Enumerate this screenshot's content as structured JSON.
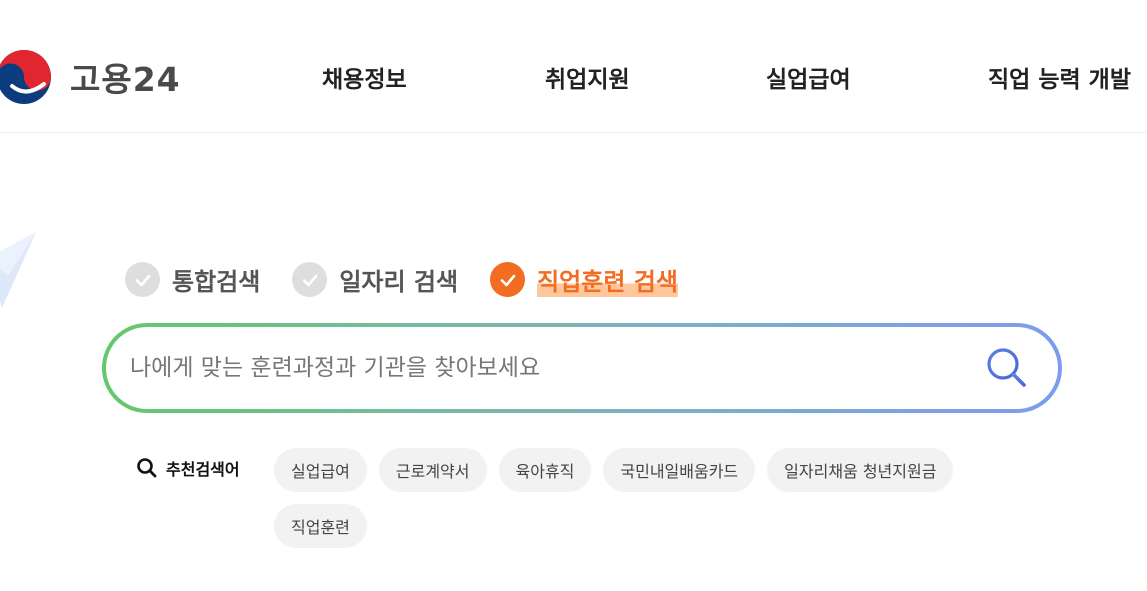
{
  "header": {
    "logo_text": "고용24",
    "nav": [
      "채용정보",
      "취업지원",
      "실업급여",
      "직업 능력 개발"
    ]
  },
  "search_tabs": [
    {
      "label": "통합검색",
      "active": false
    },
    {
      "label": "일자리 검색",
      "active": false
    },
    {
      "label": "직업훈련 검색",
      "active": true
    }
  ],
  "search": {
    "placeholder": "나에게 맞는 훈련과정과 기관을 찾아보세요",
    "value": ""
  },
  "recommended": {
    "label": "추천검색어",
    "keywords": [
      "실업급여",
      "근로계약서",
      "육아휴직",
      "국민내일배움카드",
      "일자리채움 청년지원금",
      "직업훈련"
    ]
  },
  "colors": {
    "accent": "#f26c22",
    "gradient_start": "#62c86c",
    "gradient_end": "#7b9cf0",
    "chip_bg": "#f2f2f2"
  },
  "icons": {
    "logo": "taegeuk-logo-icon",
    "tab_check": "check-icon",
    "search": "search-icon",
    "decoration": "paper-plane-icon"
  }
}
